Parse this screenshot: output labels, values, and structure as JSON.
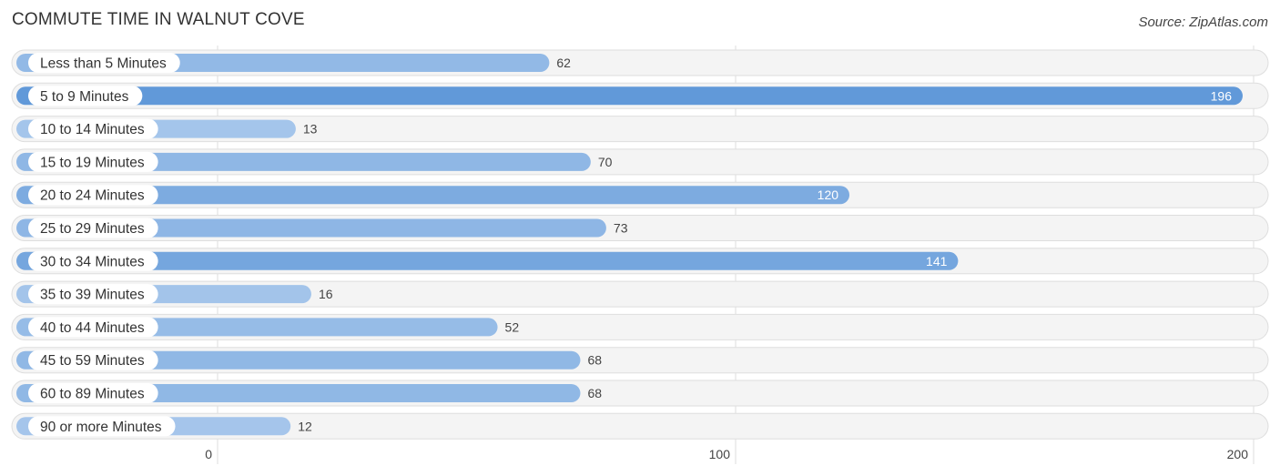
{
  "chart_data": {
    "type": "bar",
    "orientation": "horizontal",
    "title": "COMMUTE TIME IN WALNUT COVE",
    "source": "Source: ZipAtlas.com",
    "categories": [
      "Less than 5 Minutes",
      "5 to 9 Minutes",
      "10 to 14 Minutes",
      "15 to 19 Minutes",
      "20 to 24 Minutes",
      "25 to 29 Minutes",
      "30 to 34 Minutes",
      "35 to 39 Minutes",
      "40 to 44 Minutes",
      "45 to 59 Minutes",
      "60 to 89 Minutes",
      "90 or more Minutes"
    ],
    "values": [
      62,
      196,
      13,
      70,
      120,
      73,
      141,
      16,
      52,
      68,
      68,
      12
    ],
    "xlim": [
      0,
      200
    ],
    "xticks": [
      0,
      100,
      200
    ],
    "xtick_labels": [
      "0",
      "100",
      "200"
    ],
    "grid": true,
    "legend": "none",
    "colors": {
      "bar_dark": "#6199d9",
      "bar_light": "#a9c8ec",
      "track": "#f4f4f4",
      "value_inside": "#ffffff",
      "value_outside": "#444444"
    }
  }
}
